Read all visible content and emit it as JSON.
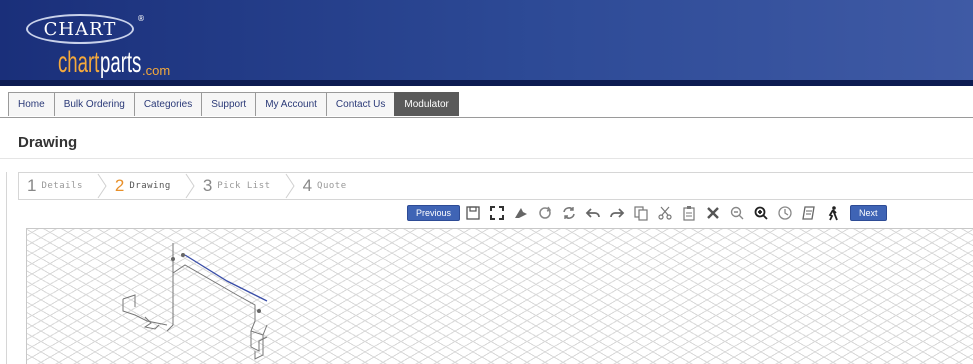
{
  "header": {
    "logo_text": "CHART",
    "brand_part1": "chart",
    "brand_part2": "parts",
    "brand_suffix": ".com",
    "colors": {
      "header_blue": "#2d4a96",
      "brand_orange": "#f4a93c"
    }
  },
  "nav": {
    "items": [
      {
        "label": "Home"
      },
      {
        "label": "Bulk Ordering"
      },
      {
        "label": "Categories"
      },
      {
        "label": "Support"
      },
      {
        "label": "My Account"
      },
      {
        "label": "Contact Us"
      },
      {
        "label": "Modulator",
        "active": true
      }
    ]
  },
  "page": {
    "title": "Drawing"
  },
  "steps": [
    {
      "num": "1",
      "label": "Details"
    },
    {
      "num": "2",
      "label": "Drawing",
      "active": true
    },
    {
      "num": "3",
      "label": "Pick List"
    },
    {
      "num": "4",
      "label": "Quote"
    }
  ],
  "toolbar": {
    "previous_label": "Previous",
    "next_label": "Next",
    "tools": [
      "save-icon",
      "fullscreen-icon",
      "delete-segment-icon",
      "rotate-icon",
      "refresh-icon",
      "undo-icon",
      "redo-icon",
      "copy-icon",
      "cut-icon",
      "paste-icon",
      "close-icon",
      "zoom-out-icon",
      "zoom-in-icon",
      "clock-icon",
      "notes-icon",
      "walk-icon"
    ]
  }
}
